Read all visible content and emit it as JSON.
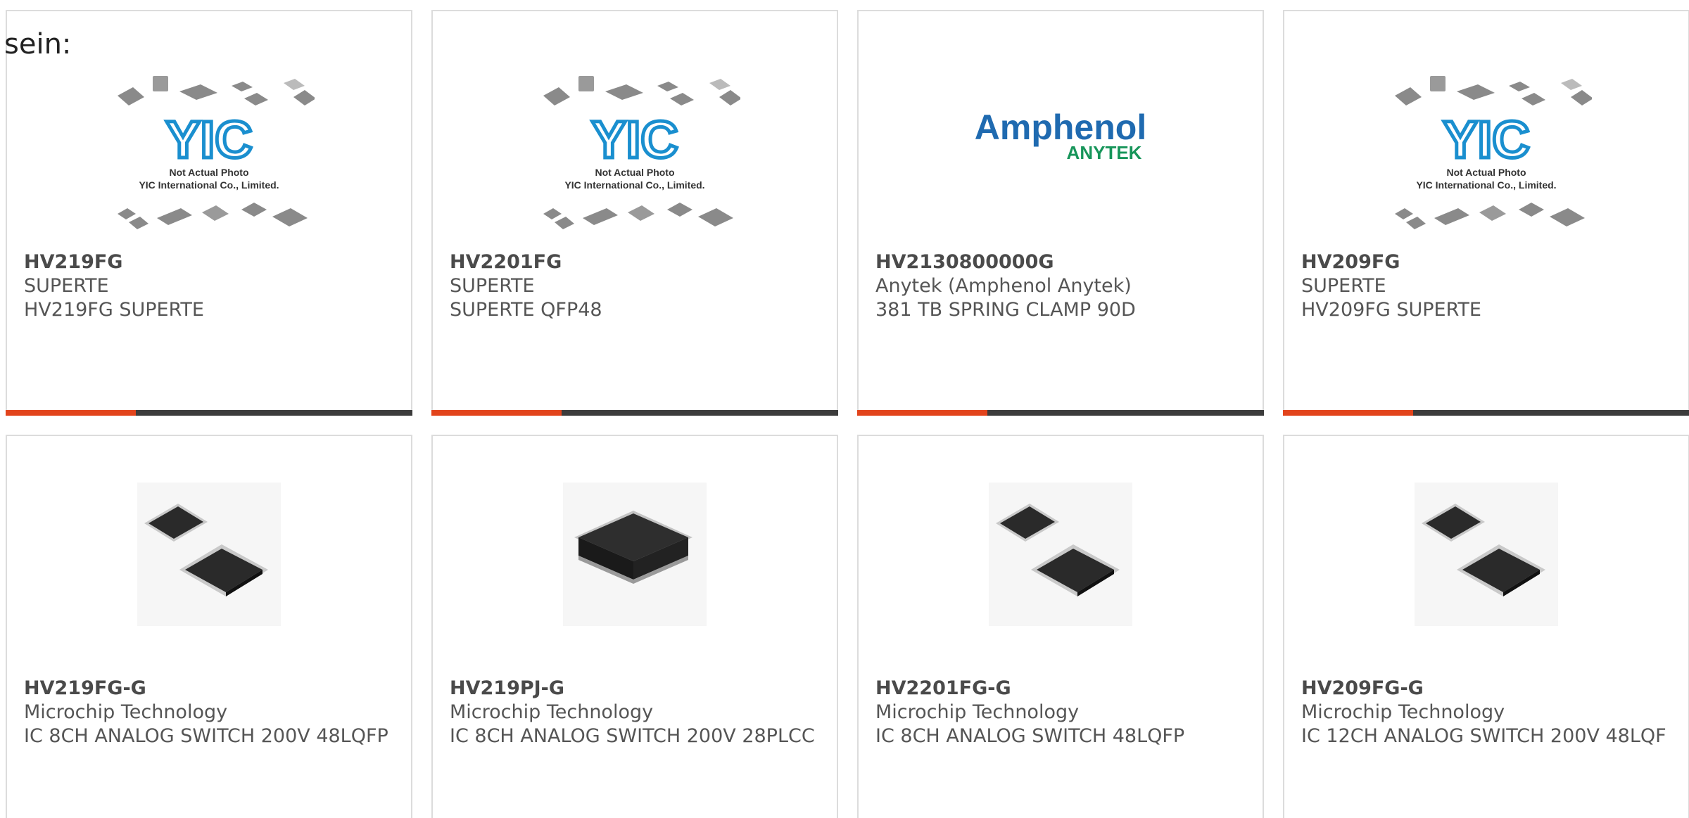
{
  "intro_text": "sein:",
  "placeholder": {
    "line1": "Not Actual Photo",
    "line2": "YIC International Co., Limited.",
    "logo": "YIC"
  },
  "amphenol_logo": {
    "main": "Amphenol",
    "sub": "ANYTEK"
  },
  "products": [
    {
      "part": "HV219FG",
      "maker": "SUPERTE",
      "desc": "HV219FG SUPERTE",
      "image": "yic-placeholder"
    },
    {
      "part": "HV2201FG",
      "maker": "SUPERTE",
      "desc": "SUPERTE QFP48",
      "image": "yic-placeholder"
    },
    {
      "part": "HV2130800000G",
      "maker": "Anytek (Amphenol Anytek)",
      "desc": "381 TB SPRING CLAMP 90D",
      "image": "amphenol-logo"
    },
    {
      "part": "HV209FG",
      "maker": "SUPERTE",
      "desc": "HV209FG SUPERTE",
      "image": "yic-placeholder"
    },
    {
      "part": "HV219FG-G",
      "maker": "Microchip Technology",
      "desc": "IC 8CH ANALOG SWITCH 200V 48LQFP",
      "image": "qfp-chip"
    },
    {
      "part": "HV219PJ-G",
      "maker": "Microchip Technology",
      "desc": "IC 8CH ANALOG SWITCH 200V 28PLCC",
      "image": "plcc-chip"
    },
    {
      "part": "HV2201FG-G",
      "maker": "Microchip Technology",
      "desc": "IC 8CH ANALOG SWITCH 48LQFP",
      "image": "qfp-chip"
    },
    {
      "part": "HV209FG-G",
      "maker": "Microchip Technology",
      "desc": "IC 12CH ANALOG SWITCH 200V 48LQF",
      "image": "qfp-chip"
    }
  ],
  "colors": {
    "accent": "#e2441c",
    "bar_dark": "#3c3c3c",
    "card_border": "#dcdcdc",
    "text": "#555555"
  }
}
